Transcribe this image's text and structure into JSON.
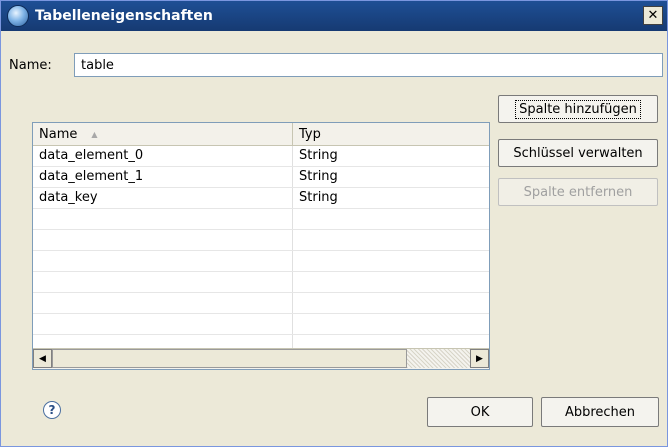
{
  "window": {
    "title": "Tabelleneigenschaften",
    "close_symbol": "✕"
  },
  "name_field": {
    "label": "Name:",
    "value": "table"
  },
  "table": {
    "columns": [
      "Name",
      "Typ"
    ],
    "rows": [
      {
        "name": "data_element_0",
        "type": "String"
      },
      {
        "name": "data_element_1",
        "type": "String"
      },
      {
        "name": "data_key",
        "type": "String"
      },
      {
        "name": "",
        "type": ""
      },
      {
        "name": "",
        "type": ""
      },
      {
        "name": "",
        "type": ""
      },
      {
        "name": "",
        "type": ""
      },
      {
        "name": "",
        "type": ""
      },
      {
        "name": "",
        "type": ""
      },
      {
        "name": "",
        "type": ""
      }
    ]
  },
  "side_buttons": {
    "add": "Spalte hinzufügen",
    "manage": "Schlüssel verwalten",
    "remove": "Spalte entfernen"
  },
  "footer": {
    "help": "?",
    "ok": "OK",
    "cancel": "Abbrechen"
  }
}
